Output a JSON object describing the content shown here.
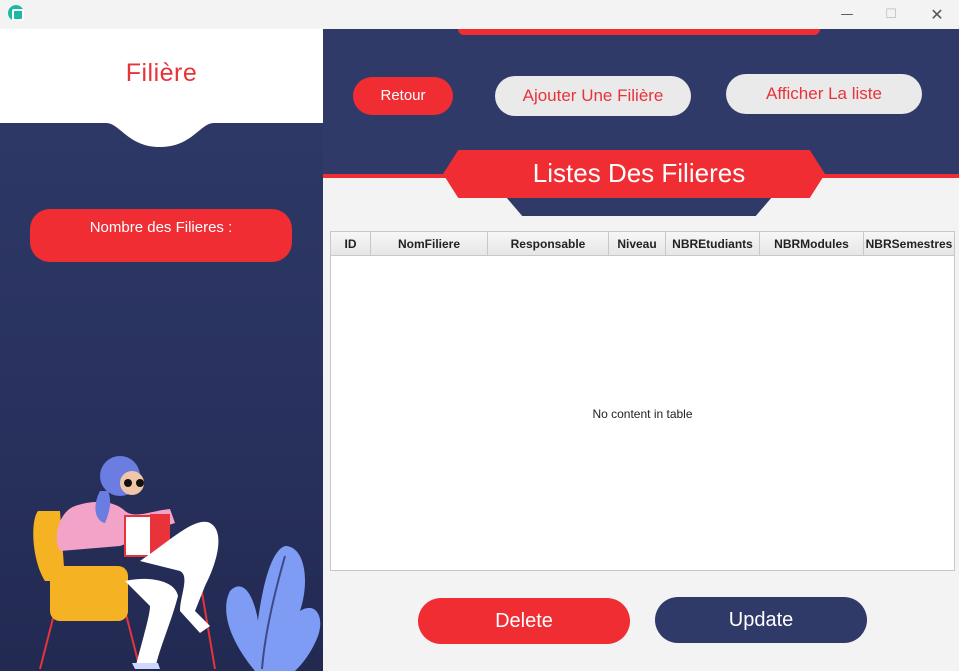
{
  "window": {
    "icon": "app-logo-icon",
    "controls": {
      "minimize": "—",
      "maximize": "☐",
      "close": "✕"
    }
  },
  "sidebar": {
    "title": "Filière",
    "nombre_label": "Nombre des Filieres :"
  },
  "toolbar": {
    "retour_label": "Retour",
    "ajouter_label": "Ajouter Une Filière",
    "afficher_label": "Afficher La liste"
  },
  "banner": {
    "title": "Listes Des Filieres"
  },
  "table": {
    "columns": [
      "ID",
      "NomFiliere",
      "Responsable",
      "Niveau",
      "NBREtudiants",
      "NBRModules",
      "NBRSemestres"
    ],
    "empty_message": "No content in table"
  },
  "actions": {
    "delete_label": "Delete",
    "update_label": "Update"
  },
  "colors": {
    "accent_red": "#ef2d33",
    "navy": "#2f3a68",
    "light_button": "#eaeaea"
  }
}
